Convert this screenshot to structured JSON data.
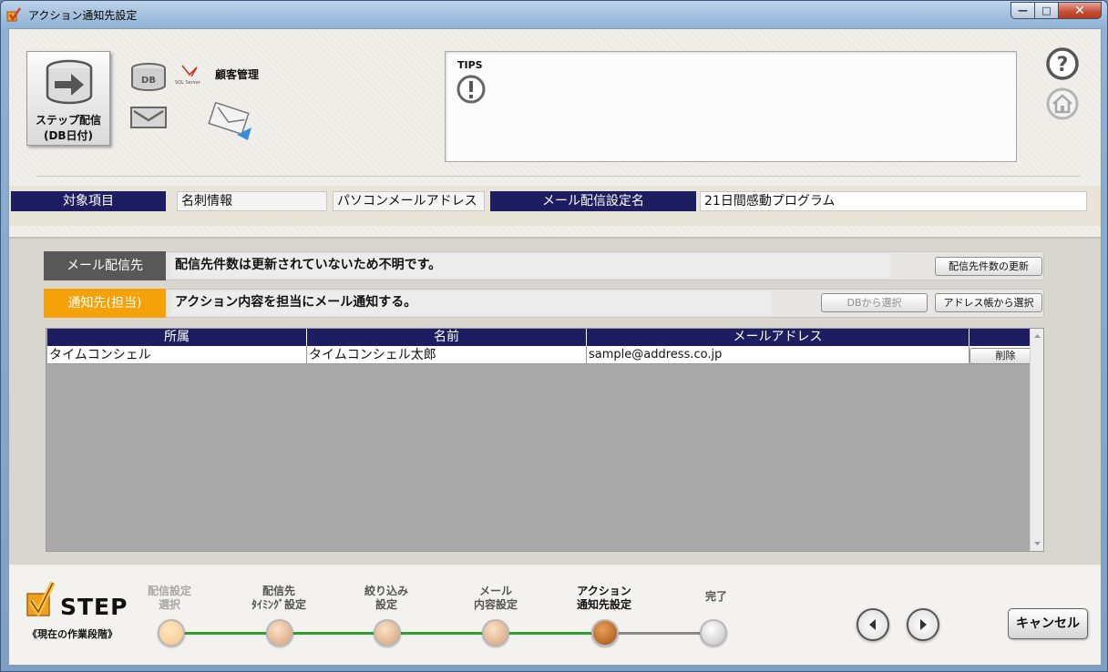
{
  "window": {
    "title": "アクション通知先設定",
    "min": "—",
    "max": "□",
    "close": "✕"
  },
  "header": {
    "main_button": {
      "line1": "ステップ配信",
      "line2": "(DB日付)"
    },
    "db_icon_text": "DB",
    "sql_logo_text": "SQL Server",
    "source_label": "顧客管理",
    "tips_title": "TIPS",
    "tips_icon": "exclamation-circle-icon"
  },
  "info": {
    "target_label": "対象項目",
    "target_value1": "名刺情報",
    "target_value2": "パソコンメールアドレス",
    "setting_label": "メール配信設定名",
    "setting_value": "21日間感動プログラム"
  },
  "delivery": {
    "label": "メール配信先",
    "status": "配信先件数は更新されていないため不明です。",
    "update_button": "配信先件数の更新"
  },
  "notify": {
    "label": "通知先(担当)",
    "description": "アクション内容を担当にメール通知する。",
    "db_select_button": "DBから選択",
    "addressbook_button": "アドレス帳から選択"
  },
  "table": {
    "columns": [
      "所属",
      "名前",
      "メールアドレス"
    ],
    "rows": [
      {
        "affiliation": "タイムコンシェル",
        "name": "タイムコンシェル太郎",
        "email": "sample@address.co.jp",
        "delete": "削除"
      }
    ]
  },
  "steps": {
    "logo": "STEP",
    "caption": "《現在の作業段階》",
    "items": [
      {
        "line1": "配信設定",
        "line2": "選択"
      },
      {
        "line1": "配信先",
        "line2": "ﾀｲﾐﾝｸﾞ設定"
      },
      {
        "line1": "絞り込み",
        "line2": "設定"
      },
      {
        "line1": "メール",
        "line2": "内容設定"
      },
      {
        "line1": "アクション",
        "line2": "通知先設定"
      },
      {
        "line1": "完了",
        "line2": ""
      }
    ],
    "current_index": 4,
    "cancel_button": "キャンセル"
  },
  "colors": {
    "navy": "#1d1d62",
    "orange": "#f5a10a",
    "progress_green": "#2ea02e",
    "current_dot": "#c0661f"
  }
}
